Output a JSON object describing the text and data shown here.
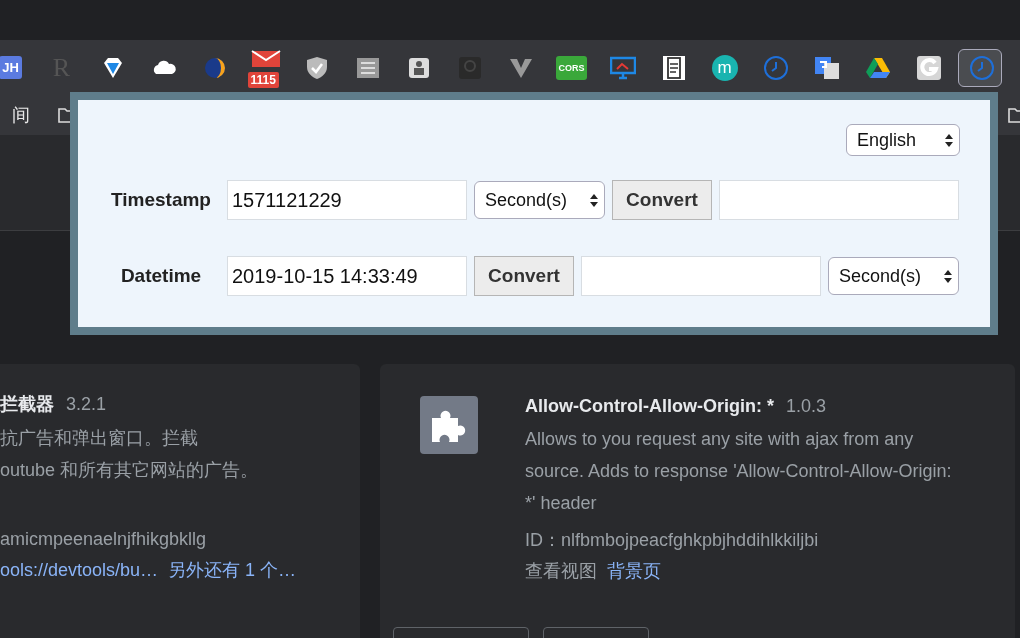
{
  "toolbar": {
    "icons": [
      {
        "kind": "tile",
        "label": "JH",
        "selected": false
      },
      {
        "kind": "letter",
        "label": "R",
        "selected": false
      },
      {
        "kind": "diamond",
        "selected": false
      },
      {
        "kind": "cloud",
        "selected": false
      },
      {
        "kind": "moon",
        "selected": false
      },
      {
        "kind": "mail",
        "badge": "1115",
        "selected": false
      },
      {
        "kind": "shield",
        "selected": false
      },
      {
        "kind": "grid",
        "selected": false
      },
      {
        "kind": "person",
        "selected": false
      },
      {
        "kind": "bulb",
        "selected": false
      },
      {
        "kind": "vee",
        "selected": false
      },
      {
        "kind": "tile-green",
        "label": "CORS",
        "selected": false
      },
      {
        "kind": "monitor",
        "selected": false
      },
      {
        "kind": "clipboard",
        "selected": false
      },
      {
        "kind": "circle",
        "label": "m",
        "selected": false
      },
      {
        "kind": "clock",
        "selected": false
      },
      {
        "kind": "translate",
        "selected": false
      },
      {
        "kind": "drive",
        "selected": false
      },
      {
        "kind": "gee",
        "selected": false
      },
      {
        "kind": "clock",
        "selected": true
      }
    ]
  },
  "bookmarks": {
    "items": [
      {
        "label": "间"
      }
    ]
  },
  "popup": {
    "language": "English",
    "rows": [
      {
        "label": "Timestamp",
        "controls": [
          {
            "kind": "input",
            "value": "1571121229"
          },
          {
            "kind": "select",
            "value": "Second(s)"
          },
          {
            "kind": "button",
            "label": "Convert"
          },
          {
            "kind": "input"
          }
        ]
      },
      {
        "label": "Datetime",
        "controls": [
          {
            "kind": "input",
            "value": "2019-10-15 14:33:49"
          },
          {
            "kind": "button",
            "label": "Convert"
          },
          {
            "kind": "input"
          },
          {
            "kind": "select",
            "value": "Second(s)"
          }
        ]
      }
    ]
  },
  "extensions": [
    {
      "name": "拦截器",
      "version": "3.2.1",
      "description": [
        "抗广告和弹出窗口。拦截",
        "outube 和所有其它网站的广告。"
      ],
      "id": "amicmpeenaelnjfhikgbkllg",
      "links": [
        "ools://devtools/bu…",
        "另外还有 1 个…"
      ]
    },
    {
      "name": "Allow-Control-Allow-Origin: *",
      "version": "1.0.3",
      "description": [
        "Allows to you request any site with ajax from any source. Adds to response 'Allow-Control-Allow-Origin: *' header"
      ],
      "id": "ID：nlfbmbojpeacfghkpbjhddihlkkiljbi",
      "views_label": "查看视图",
      "links": [
        "背景页"
      ]
    }
  ]
}
